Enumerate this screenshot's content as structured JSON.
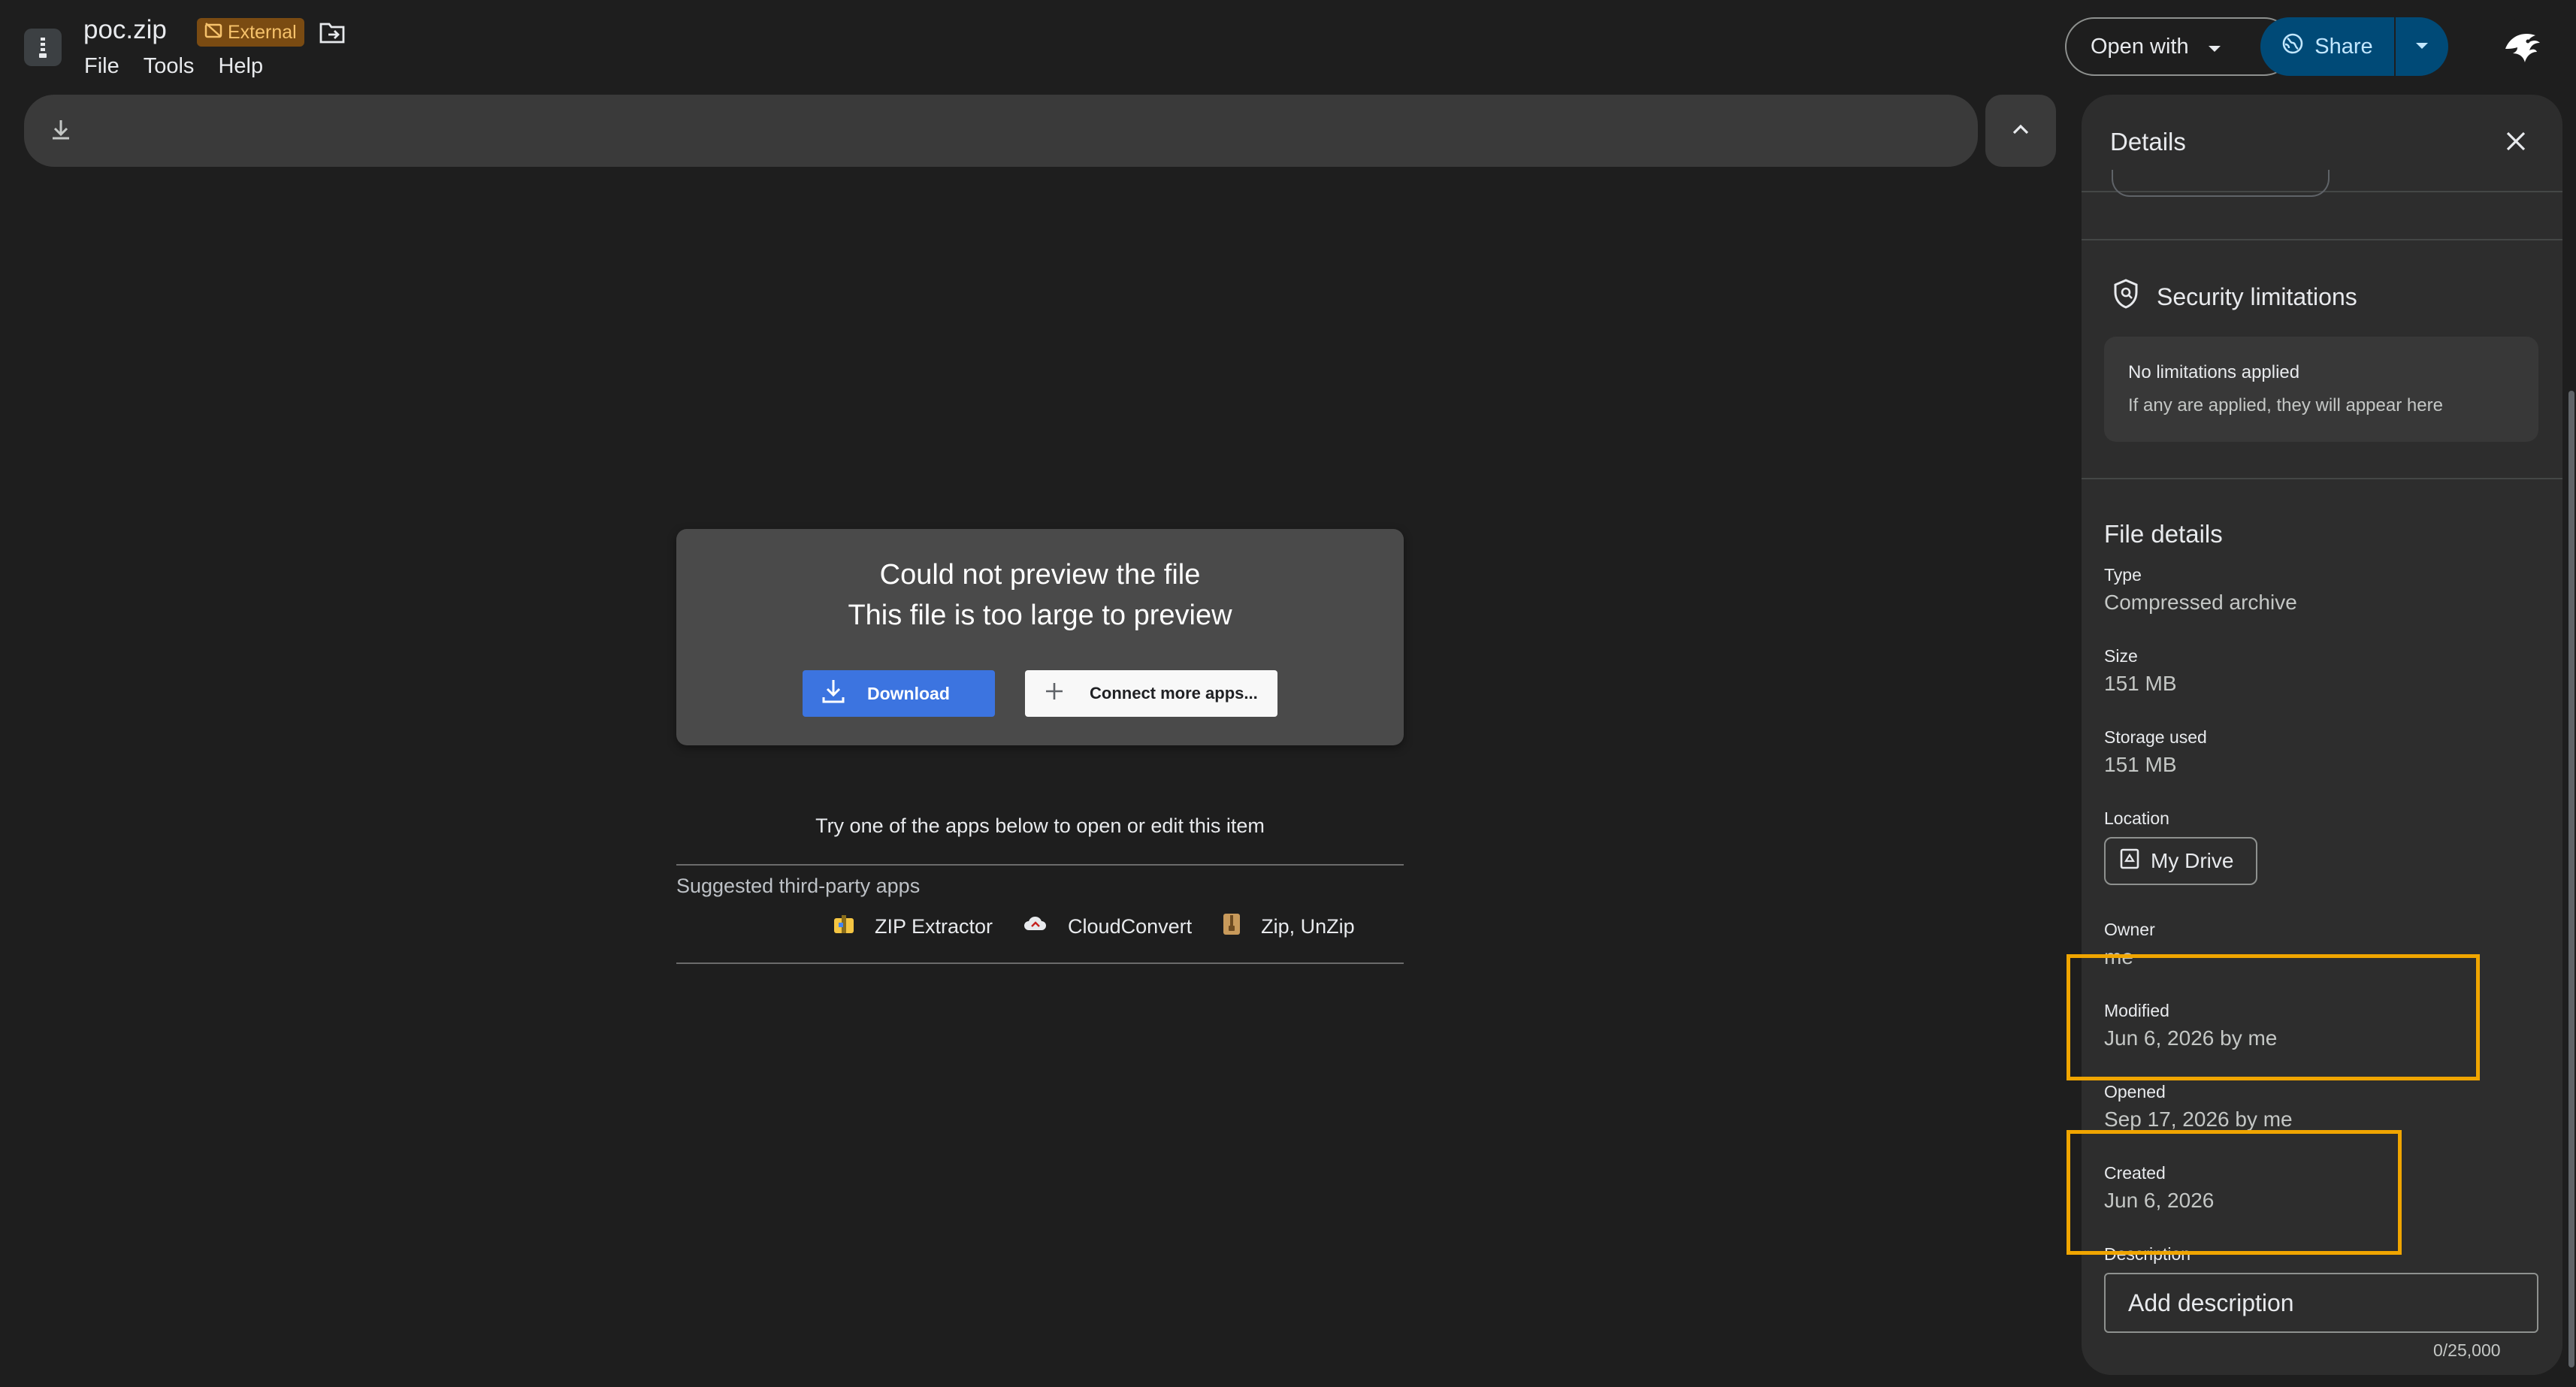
{
  "header": {
    "file_name": "poc.zip",
    "badge_label": "External",
    "menu": [
      "File",
      "Tools",
      "Help"
    ],
    "open_with_label": "Open with",
    "share_label": "Share",
    "app_icon": "zip-file-icon",
    "avatar_icon": "eagle-avatar-icon"
  },
  "preview": {
    "error_title": "Could not preview the file",
    "error_subtitle": "This file is too large to preview",
    "download_label": "Download",
    "connect_label": "Connect more apps...",
    "try_text": "Try one of the apps below to open or edit this item",
    "suggested_label": "Suggested third-party apps",
    "apps": [
      "ZIP Extractor",
      "CloudConvert",
      "Zip, UnZip"
    ]
  },
  "details": {
    "title": "Details",
    "security_title": "Security limitations",
    "limits_title": "No limitations applied",
    "limits_text": "If any are applied, they will appear here",
    "file_details_title": "File details",
    "type_label": "Type",
    "type_value": "Compressed archive",
    "size_label": "Size",
    "size_value": "151 MB",
    "storage_label": "Storage used",
    "storage_value": "151 MB",
    "location_label": "Location",
    "location_value": "My Drive",
    "owner_label": "Owner",
    "owner_value": "me",
    "modified_label": "Modified",
    "modified_value": "Jun 6, 2026 by me",
    "opened_label": "Opened",
    "opened_value": "Sep 17, 2026 by me",
    "created_label": "Created",
    "created_value": "Jun 6, 2026",
    "description_label": "Description",
    "description_placeholder": "Add description",
    "counter": "0/25,000"
  },
  "colors": {
    "background": "#1e1e1e",
    "panel": "#2d2d2d",
    "share_button": "#004a77",
    "download_button": "#3c74e0",
    "highlight": "#f0a500",
    "external_badge": "#7a4b12"
  }
}
